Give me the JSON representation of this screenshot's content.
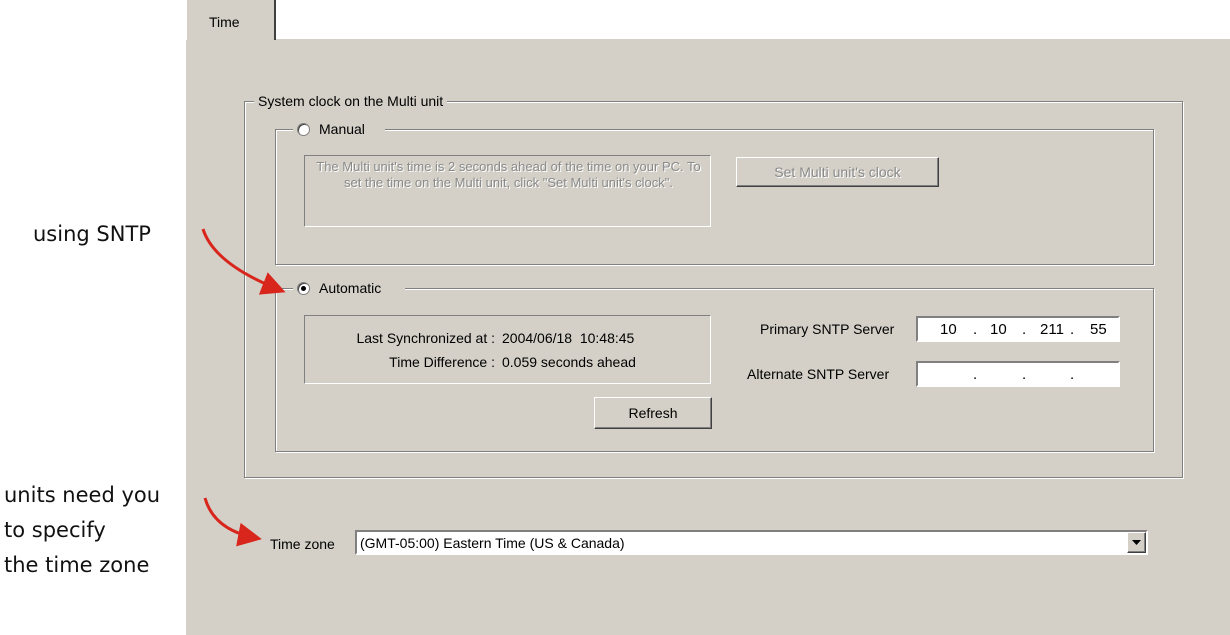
{
  "tab": {
    "label": "Time"
  },
  "annotations": {
    "sntp": "using SNTP",
    "tz": [
      "units need you",
      "to specify",
      "the time zone"
    ]
  },
  "system_clock": {
    "group_label": "System clock on the Multi unit",
    "manual": {
      "label": "Manual",
      "selected": false,
      "message": "The Multi unit's time is 2 seconds ahead of the time on your PC. To set the time on the Multi unit, click \"Set Multi unit's clock\".",
      "set_button": "Set Multi unit's clock"
    },
    "automatic": {
      "label": "Automatic",
      "selected": true,
      "last_sync_label": "Last Synchronized at :",
      "last_sync_value": "2004/06/18  10:48:45",
      "time_diff_label": "Time Difference :",
      "time_diff_value": "0.059 seconds ahead",
      "refresh_button": "Refresh",
      "primary_label": "Primary SNTP Server",
      "primary_ip": [
        "10",
        "10",
        "211",
        "55"
      ],
      "alternate_label": "Alternate SNTP Server",
      "alternate_ip": [
        "",
        "",
        "",
        ""
      ]
    }
  },
  "time_zone": {
    "label": "Time zone",
    "selected": "(GMT-05:00) Eastern Time (US & Canada)"
  },
  "colors": {
    "face": "#d4d0c8",
    "arrow": "#d9261c"
  }
}
